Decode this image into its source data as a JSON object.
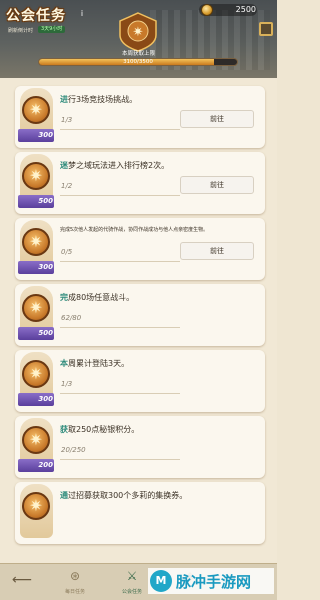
{
  "header": {
    "title": "公会任务",
    "info_icon": "info-icon",
    "refresh_label": "刷新倒计时",
    "refresh_time": "3天9小时",
    "currency_value": "2500",
    "cap_label": "本周获取上限",
    "progress_text": "3100/3500",
    "progress_fraction": 0.886
  },
  "tasks": [
    {
      "first": "进",
      "rest": "行3场竞技场挑战。",
      "progress": "1/3",
      "reward": "300",
      "button": "前往",
      "small": false
    },
    {
      "first": "迷",
      "rest": "梦之域玩法进入排行榜2次。",
      "progress": "1/2",
      "reward": "500",
      "button": "前往",
      "small": false
    },
    {
      "first": "",
      "rest": "完成5次他人发起的代骑作战，协同作战成功与他人点亲密度生物。",
      "progress": "0/5",
      "reward": "300",
      "button": "前往",
      "small": true
    },
    {
      "first": "完",
      "rest": "成80场任意战斗。",
      "progress": "62/80",
      "reward": "500",
      "button": "",
      "small": false
    },
    {
      "first": "本",
      "rest": "周累计登陆3天。",
      "progress": "1/3",
      "reward": "300",
      "button": "",
      "small": false
    },
    {
      "first": "获",
      "rest": "取250点秘银积分。",
      "progress": "20/250",
      "reward": "200",
      "button": "",
      "small": false
    },
    {
      "first": "通",
      "rest": "过招募获取300个多莉的集换券。",
      "progress": "",
      "reward": "",
      "button": "",
      "small": false
    }
  ],
  "nav": {
    "back_icon": "back-arrow-icon",
    "items": [
      {
        "label": "每日任务",
        "icon": "daily-task-icon"
      },
      {
        "label": "公会任务",
        "icon": "guild-task-icon"
      },
      {
        "label": "",
        "icon": "tab-icon"
      }
    ]
  },
  "watermark": {
    "text": "脉冲手游网",
    "logo": "M"
  },
  "colors": {
    "accent_teal": "#2c8a7a",
    "reward_purple": "#5a3f9c",
    "header_bg": "#4a4f52"
  }
}
